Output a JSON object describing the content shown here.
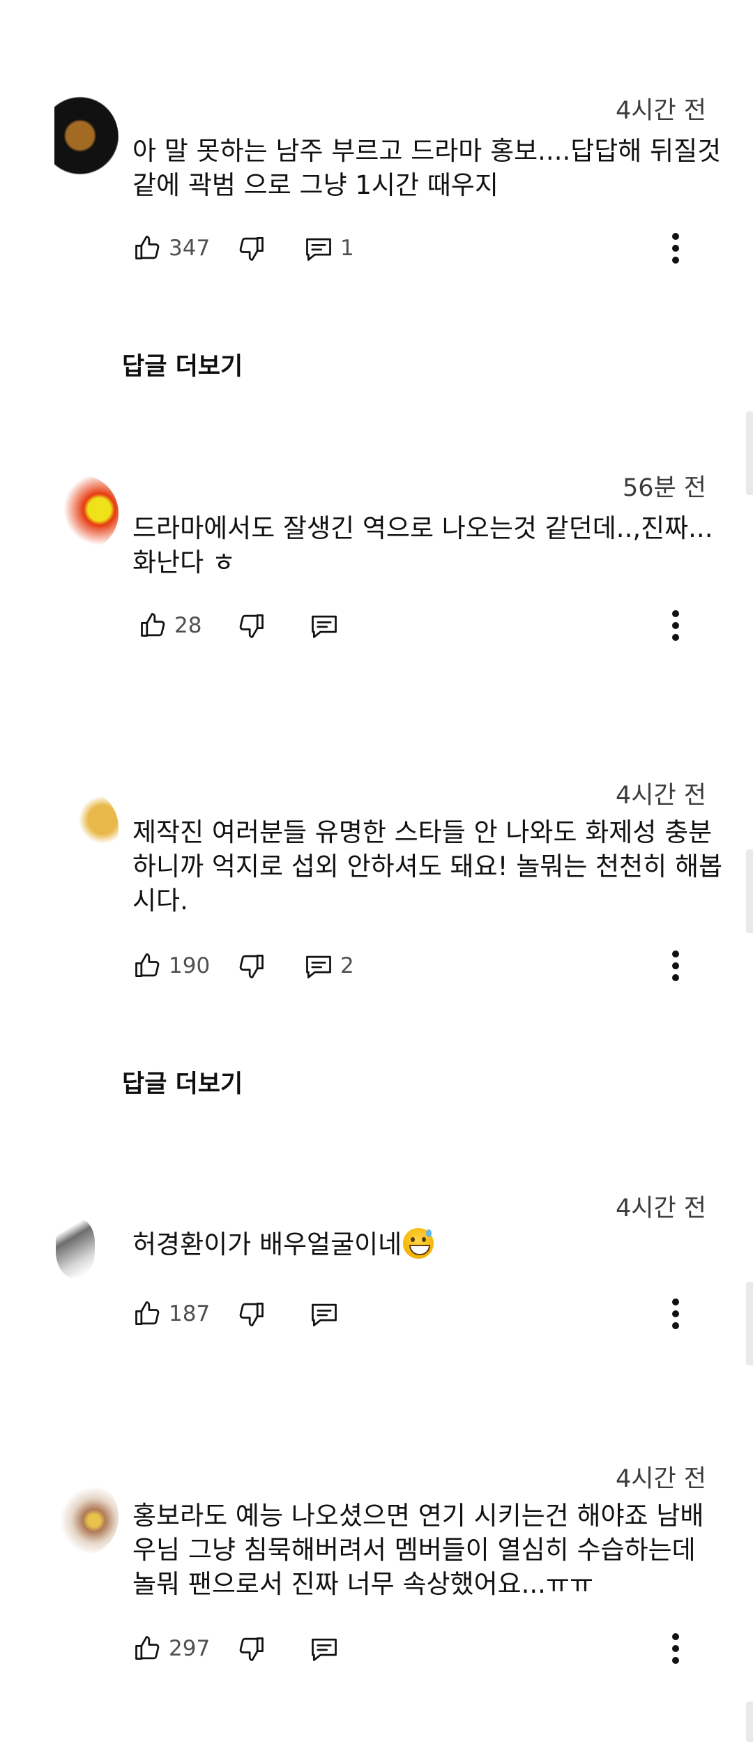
{
  "comments": [
    {
      "handle": "",
      "time": "4시간 전",
      "text": "아 말 못하는 남주 부르고 드라마 홍보....답답해 뒤질것 같에 곽범 으로 그냥 1시간 때우지",
      "likes": "347",
      "replies_count": "1",
      "more_replies_label": "답글 더보기"
    },
    {
      "handle": "",
      "time": "56분 전",
      "text": "드라마에서도 잘생긴 역으로 나오는것 같던데..,진짜... 화난다 ㅎ",
      "likes": "28",
      "replies_count": ""
    },
    {
      "handle": "",
      "time": "4시간 전",
      "text": "제작진 여러분들 유명한 스타들 안 나와도 화제성 충분하니까 억지로 섭외 안하셔도 돼요! 놀뭐는 천천히 해봅시다.",
      "likes": "190",
      "replies_count": "2",
      "more_replies_label": "답글 더보기"
    },
    {
      "handle": "",
      "time": "4시간 전",
      "text": "허경환이가 배우얼굴이네",
      "likes": "187",
      "replies_count": ""
    },
    {
      "handle": "",
      "time": "4시간 전",
      "text": "홍보라도 예능 나오셨으면 연기 시키는건 해야죠 남배우님 그냥 침묵해버려서 멤버들이 열심히 수습하는데 놀뭐 팬으로서 진짜 너무 속상했어요...ㅠㅠ",
      "likes": "297",
      "replies_count": ""
    }
  ],
  "icons": {
    "like": "thumbs-up-icon",
    "dislike": "thumbs-down-icon",
    "reply": "comment-icon",
    "more": "more-vert-icon",
    "emoji": "grinning-sweat-emoji"
  },
  "colors": {
    "text": "#0f0f0f",
    "meta": "#505050",
    "background": "#ffffff"
  }
}
